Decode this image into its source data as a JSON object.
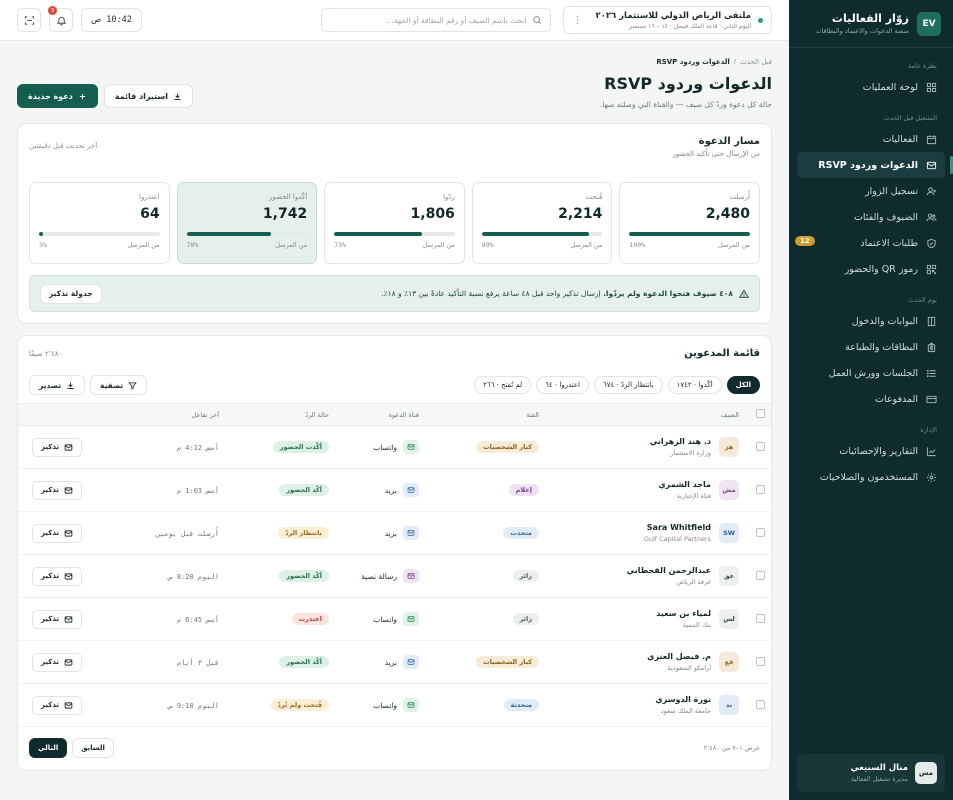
{
  "brand": {
    "logo": "EV",
    "title": "زوّار الفعاليات",
    "subtitle": "منصة الدعوات والاعتماد والبطاقات"
  },
  "sidebar": {
    "sections": [
      {
        "title": "نظرة عامة",
        "items": [
          {
            "label": "لوحة العمليات",
            "icon": "dashboard-icon"
          }
        ]
      },
      {
        "title": "التشغيل قبل الحدث",
        "items": [
          {
            "label": "الفعاليات",
            "icon": "calendar-icon"
          },
          {
            "label": "الدعوات وردود RSVP",
            "icon": "mail-icon",
            "active": true
          },
          {
            "label": "تسجيل الزوار",
            "icon": "user-plus-icon"
          },
          {
            "label": "الضيوف والفئات",
            "icon": "users-icon"
          },
          {
            "label": "طلبات الاعتماد",
            "icon": "shield-icon",
            "badge": "12"
          },
          {
            "label": "رموز QR والحضور",
            "icon": "qr-icon"
          }
        ]
      },
      {
        "title": "يوم الحدث",
        "items": [
          {
            "label": "البوابات والدخول",
            "icon": "door-icon"
          },
          {
            "label": "البطاقات والطباعة",
            "icon": "badge-icon"
          },
          {
            "label": "الجلسات وورش العمل",
            "icon": "list-icon"
          },
          {
            "label": "المدفوعات",
            "icon": "card-icon"
          }
        ]
      },
      {
        "title": "الإدارة",
        "items": [
          {
            "label": "التقارير والإحصائيات",
            "icon": "chart-icon"
          },
          {
            "label": "المستخدمون والصلاحيات",
            "icon": "gear-icon"
          }
        ]
      }
    ]
  },
  "user": {
    "initials": "مس",
    "name": "منال السبيعي",
    "role": "مديرة تشغيل الفعالية"
  },
  "header": {
    "event_title": "ملتقى الرياض الدولي للاستثمار ٢٠٢٦",
    "event_sub": "اليوم الثاني · قاعة الملك فيصل · ١٤ – ١٦ سبتمبر",
    "search_placeholder": "ابحث باسم الضيف أو رقم البطاقة أو الجهة…",
    "clock": "10:42",
    "clock_period": "ص",
    "notif_count": "3"
  },
  "page": {
    "breadcrumb_parent": "قبل الحدث",
    "breadcrumb_sep": "/",
    "breadcrumb_current": "الدعوات وردود RSVP",
    "title": "الدعوات وردود RSVP",
    "subtitle": "حالة كل دعوة وردّ كل ضيف — والقناة التي وصلته منها.",
    "import_label": "استيراد قائمة",
    "new_label": "دعوة جديدة"
  },
  "funnel": {
    "title": "مسار الدعوة",
    "subtitle": "من الإرسال حتى تأكيد الحضور",
    "updated": "آخر تحديث قبل دقيقتين",
    "of_label": "من المرسل",
    "stages": [
      {
        "label": "أُرسلت",
        "value": "2,480",
        "pct": "100%",
        "fill": 1.0
      },
      {
        "label": "فُتحت",
        "value": "2,214",
        "pct": "89%",
        "fill": 0.89
      },
      {
        "label": "ردّوا",
        "value": "1,806",
        "pct": "73%",
        "fill": 0.73
      },
      {
        "label": "أكّدوا الحضور",
        "value": "1,742",
        "pct": "70%",
        "fill": 0.7,
        "highlight": true
      },
      {
        "label": "اعتذروا",
        "value": "64",
        "pct": "3%",
        "fill": 0.03
      }
    ],
    "alert_bold": "٤٠٨ ضيوف فتحوا الدعوة ولم يردّوا.",
    "alert_rest": " إرسال تذكير واحد قبل ٤٨ ساعة يرفع نسبة التأكيد عادةً بين ١٣٪ و ١٨٪.",
    "alert_button": "جدولة تذكير"
  },
  "list": {
    "title": "قائمة المدعوين",
    "count": "٢٬٤٨٠ ضيفًا",
    "chips": [
      {
        "label": "الكل",
        "active": true
      },
      {
        "label": "أكّدوا · ١٧٤٢"
      },
      {
        "label": "بانتظار الردّ · ٦٧٤"
      },
      {
        "label": "اعتذروا · ٦٤"
      },
      {
        "label": "لم تُفتح · ٢٦٦"
      }
    ],
    "filter_label": "تصفية",
    "export_label": "تصدير",
    "columns": [
      "الضيف",
      "الفئة",
      "قناة الدعوة",
      "حالة الردّ",
      "آخر تفاعل"
    ],
    "remind_label": "تذكير",
    "rows": [
      {
        "initials": "هز",
        "avatar_bg": "#f5ead9",
        "avatar_fg": "#9a6b1e",
        "name": "د. هند الزهراني",
        "org": "وزارة الاستثمار",
        "category": "كبار الشخصيات",
        "cat_bg": "#f7ecd8",
        "cat_fg": "#8a5e16",
        "channel": "واتساب",
        "ch_bg": "#e1f2e7",
        "ch_fg": "#2b8a55",
        "status": "أكّدت الحضور",
        "st_bg": "#dff1e6",
        "st_fg": "#22734a",
        "last": "أمس 4:12 م"
      },
      {
        "initials": "مش",
        "avatar_bg": "#efe4f3",
        "avatar_fg": "#7a3f8c",
        "name": "ماجد الشمري",
        "org": "قناة الإخبارية",
        "category": "إعلام",
        "cat_bg": "#efe2f3",
        "cat_fg": "#7a3f8c",
        "channel": "بريد",
        "ch_bg": "#e2ecf7",
        "ch_fg": "#3a6ea8",
        "status": "أكّد الحضور",
        "st_bg": "#dff1e6",
        "st_fg": "#22734a",
        "last": "أمس 1:03 م"
      },
      {
        "initials": "SW",
        "avatar_bg": "#e2ecf7",
        "avatar_fg": "#2f5f96",
        "name": "Sara Whitfield",
        "org": "Gulf Capital Partners",
        "category": "متحدث",
        "cat_bg": "#e2ecf7",
        "cat_fg": "#2f5f96",
        "channel": "بريد",
        "ch_bg": "#e2ecf7",
        "ch_fg": "#3a6ea8",
        "status": "بانتظار الردّ",
        "st_bg": "#fbeed7",
        "st_fg": "#a06a12",
        "last": "أُرسلت قبل يومين"
      },
      {
        "initials": "عق",
        "avatar_bg": "#edf0ef",
        "avatar_fg": "#3d4c4a",
        "name": "عبدالرحمن القحطاني",
        "org": "غرفة الرياض",
        "category": "زائر",
        "cat_bg": "#eceff0",
        "cat_fg": "#4d5b59",
        "channel": "رسالة نصية",
        "ch_bg": "#efe2f3",
        "ch_fg": "#7a3f8c",
        "status": "أكّد الحضور",
        "st_bg": "#dff1e6",
        "st_fg": "#22734a",
        "last": "اليوم 8:20 ص"
      },
      {
        "initials": "لس",
        "avatar_bg": "#edf0ef",
        "avatar_fg": "#3d4c4a",
        "name": "لمياء بن سعيد",
        "org": "بنك التنمية",
        "category": "زائر",
        "cat_bg": "#eceff0",
        "cat_fg": "#4d5b59",
        "channel": "واتساب",
        "ch_bg": "#e1f2e7",
        "ch_fg": "#2b8a55",
        "status": "اعتذرت",
        "st_bg": "#fbe3e0",
        "st_fg": "#b13d31",
        "last": "أمس 6:45 م"
      },
      {
        "initials": "فع",
        "avatar_bg": "#f5ead9",
        "avatar_fg": "#9a6b1e",
        "name": "م. فيصل العنزي",
        "org": "أرامكو السعودية",
        "category": "كبار الشخصيات",
        "cat_bg": "#f7ecd8",
        "cat_fg": "#8a5e16",
        "channel": "بريد",
        "ch_bg": "#e2ecf7",
        "ch_fg": "#3a6ea8",
        "status": "أكّد الحضور",
        "st_bg": "#dff1e6",
        "st_fg": "#22734a",
        "last": "قبل ٣ أيام"
      },
      {
        "initials": "ند",
        "avatar_bg": "#e2ecf7",
        "avatar_fg": "#2f5f96",
        "name": "نورة الدوسري",
        "org": "جامعة الملك سعود",
        "category": "متحدثة",
        "cat_bg": "#e2ecf7",
        "cat_fg": "#2f5f96",
        "channel": "واتساب",
        "ch_bg": "#e1f2e7",
        "ch_fg": "#2b8a55",
        "status": "فُتحت ولم تُردّ",
        "st_bg": "#fbeed7",
        "st_fg": "#a06a12",
        "last": "اليوم 9:10 ص"
      }
    ],
    "pager_info": "عرض ١–٧ من ٢٬٤٨٠",
    "prev_label": "السابق",
    "next_label": "التالي"
  }
}
